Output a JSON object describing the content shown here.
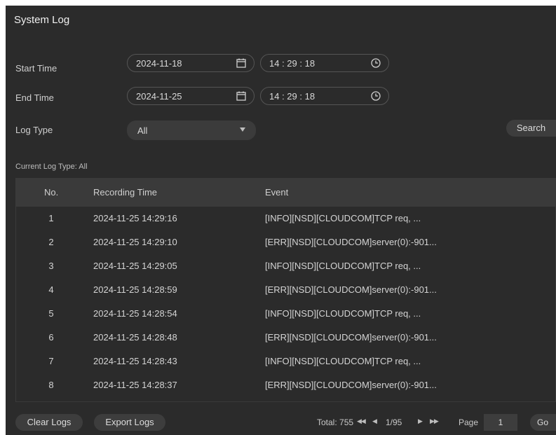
{
  "title": "System Log",
  "filters": {
    "start_time_label": "Start Time",
    "start_date": "2024-11-18",
    "start_clock": "14 : 29 : 18",
    "end_time_label": "End Time",
    "end_date": "2024-11-25",
    "end_clock": "14 : 29 : 18",
    "log_type_label": "Log Type",
    "log_type_value": "All",
    "search_label": "Search"
  },
  "current_log_type": "Current Log Type: All",
  "table": {
    "columns": [
      "No.",
      "Recording Time",
      "Event"
    ],
    "rows": [
      {
        "no": "1",
        "time": "2024-11-25 14:29:16",
        "event": "[INFO][NSD][CLOUDCOM]TCP req, ..."
      },
      {
        "no": "2",
        "time": "2024-11-25 14:29:10",
        "event": "[ERR][NSD][CLOUDCOM]server(0):-901..."
      },
      {
        "no": "3",
        "time": "2024-11-25 14:29:05",
        "event": "[INFO][NSD][CLOUDCOM]TCP req, ..."
      },
      {
        "no": "4",
        "time": "2024-11-25 14:28:59",
        "event": "[ERR][NSD][CLOUDCOM]server(0):-901..."
      },
      {
        "no": "5",
        "time": "2024-11-25 14:28:54",
        "event": "[INFO][NSD][CLOUDCOM]TCP req, ..."
      },
      {
        "no": "6",
        "time": "2024-11-25 14:28:48",
        "event": "[ERR][NSD][CLOUDCOM]server(0):-901..."
      },
      {
        "no": "7",
        "time": "2024-11-25 14:28:43",
        "event": "[INFO][NSD][CLOUDCOM]TCP req, ..."
      },
      {
        "no": "8",
        "time": "2024-11-25 14:28:37",
        "event": "[ERR][NSD][CLOUDCOM]server(0):-901..."
      }
    ]
  },
  "footer": {
    "clear_label": "Clear Logs",
    "export_label": "Export Logs",
    "total": "Total: 755",
    "page_indicator": "1/95",
    "page_label": "Page",
    "page_input": "1",
    "go_label": "Go"
  },
  "icons": {
    "calendar": "calendar-icon",
    "clock": "clock-icon",
    "first": "first-page-icon",
    "prev": "prev-page-icon",
    "next": "next-page-icon",
    "last": "last-page-icon"
  }
}
